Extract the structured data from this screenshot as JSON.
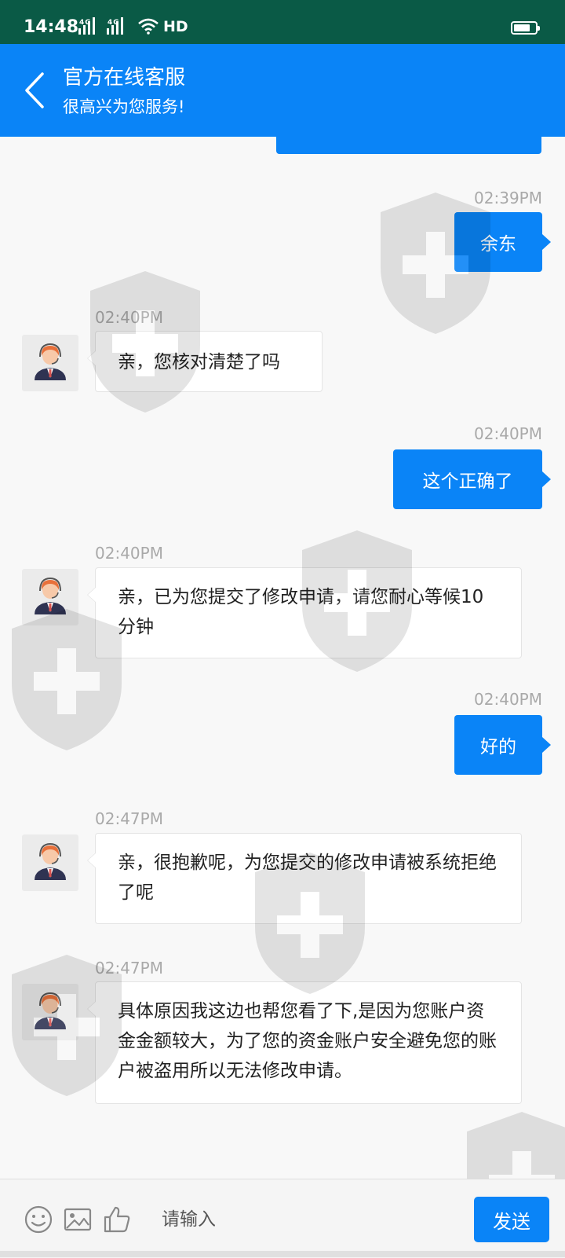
{
  "status_bar": {
    "time": "14:48",
    "network_1": "4G",
    "network_2": "4G",
    "hd": "HD"
  },
  "header": {
    "title": "官方在线客服",
    "subtitle": "很高兴为您服务!"
  },
  "messages": [
    {
      "side": "right",
      "time": "02:39PM",
      "text": "余东"
    },
    {
      "side": "left",
      "time": "02:40PM",
      "text": "亲，您核对清楚了吗"
    },
    {
      "side": "right",
      "time": "02:40PM",
      "text": "这个正确了"
    },
    {
      "side": "left",
      "time": "02:40PM",
      "text": "亲，已为您提交了修改申请，请您耐心等候10分钟"
    },
    {
      "side": "right",
      "time": "02:40PM",
      "text": "好的"
    },
    {
      "side": "left",
      "time": "02:47PM",
      "text": "亲，很抱歉呢，为您提交的修改申请被系统拒绝了呢"
    },
    {
      "side": "left",
      "time": "02:47PM",
      "text": "具体原因我这边也帮您看了下,是因为您账户资金金额较大，为了您的资金账户安全避免您的账户被盗用所以无法修改申请。"
    }
  ],
  "input_bar": {
    "placeholder": "请输入",
    "send_label": "发送"
  },
  "colors": {
    "status_bar": "#0a5a46",
    "accent": "#0a84f7",
    "chat_background": "#f8f8f8"
  },
  "icons": [
    "back-arrow-icon",
    "signal-icon",
    "wifi-icon",
    "battery-icon",
    "agent-avatar-icon",
    "emoji-icon",
    "image-icon",
    "thumbs-up-icon",
    "shield-watermark-icon"
  ]
}
